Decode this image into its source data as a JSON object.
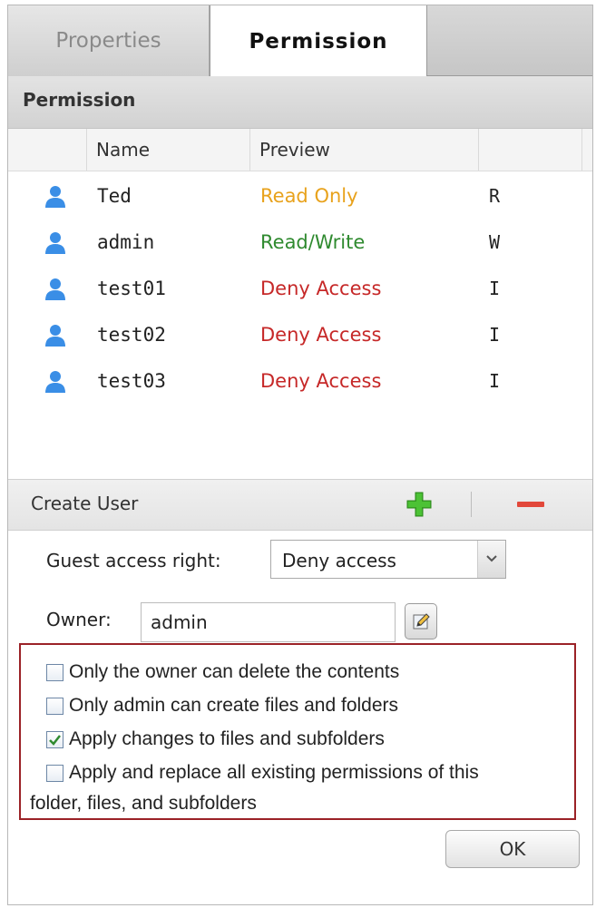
{
  "tabs": [
    {
      "label": "Properties",
      "active": false
    },
    {
      "label": "Permission",
      "active": true
    }
  ],
  "section_title": "Permission",
  "columns": {
    "name": "Name",
    "preview": "Preview"
  },
  "users": [
    {
      "name": "Ted",
      "preview": "Read Only",
      "preview_color": "#e8a21c",
      "extra": "R"
    },
    {
      "name": "admin",
      "preview": "Read/Write",
      "preview_color": "#2f8a2f",
      "extra": "W"
    },
    {
      "name": "test01",
      "preview": "Deny Access",
      "preview_color": "#c62828",
      "extra": "I"
    },
    {
      "name": "test02",
      "preview": "Deny Access",
      "preview_color": "#c62828",
      "extra": "I"
    },
    {
      "name": "test03",
      "preview": "Deny Access",
      "preview_color": "#c62828",
      "extra": "I"
    }
  ],
  "toolbar": {
    "create_user_label": "Create User",
    "add_icon": "plus-icon",
    "remove_icon": "minus-icon"
  },
  "guest_access": {
    "label": "Guest access right:",
    "value": "Deny access"
  },
  "owner": {
    "label": "Owner:",
    "value": "admin",
    "edit_icon": "edit-icon"
  },
  "options": [
    {
      "label": "Only the owner can delete the contents",
      "checked": false
    },
    {
      "label": "Only admin can create files and folders",
      "checked": false
    },
    {
      "label": "Apply changes to files and subfolders",
      "checked": true
    },
    {
      "label_line1": "Apply and replace all existing permissions of this",
      "label_line2": "folder, files, and subfolders",
      "checked": false
    }
  ],
  "ok_label": "OK",
  "colors": {
    "user_icon": "#3a8ee6",
    "highlight_border": "#9b2227",
    "add": "#3fae2a",
    "remove": "#e2483a"
  }
}
